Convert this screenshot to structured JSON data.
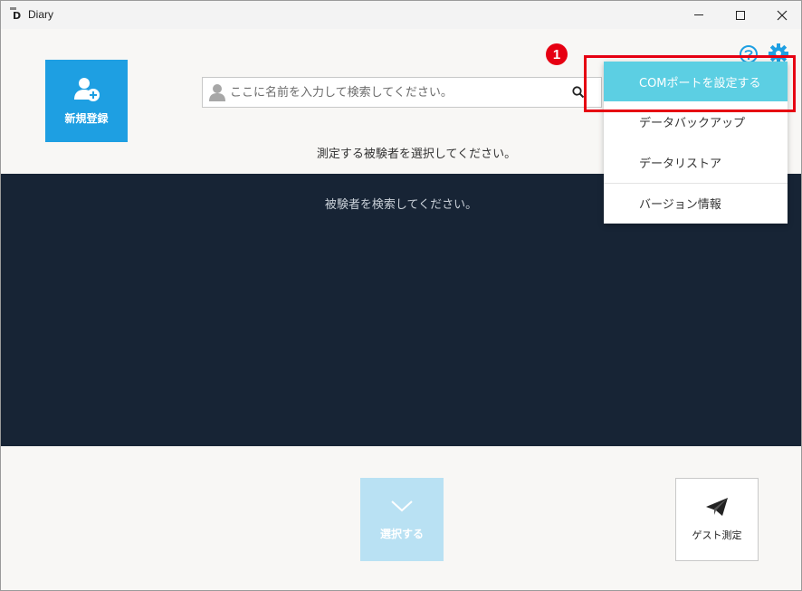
{
  "window": {
    "title": "Diary",
    "icon_letter": "D"
  },
  "toolbar": {
    "new_register_label": "新規登録",
    "search_placeholder": "ここに名前を入力して検索してください。"
  },
  "main": {
    "instruction": "測定する被験者を選択してください。",
    "results_empty": "被験者を検索してください。"
  },
  "footer": {
    "select_label": "選択する",
    "guest_label": "ゲスト測定"
  },
  "settings_menu": {
    "items": [
      {
        "label": "COMポートを設定する",
        "active": true
      },
      {
        "label": "データバックアップ",
        "active": false
      },
      {
        "label": "データリストア",
        "active": false
      },
      {
        "label": "バージョン情報",
        "active": false
      }
    ]
  },
  "annotation": {
    "badge": "1"
  },
  "colors": {
    "accent": "#1e9fe2",
    "menu_active": "#5ccfe3",
    "results_bg": "#172435",
    "highlight": "#e60012"
  }
}
